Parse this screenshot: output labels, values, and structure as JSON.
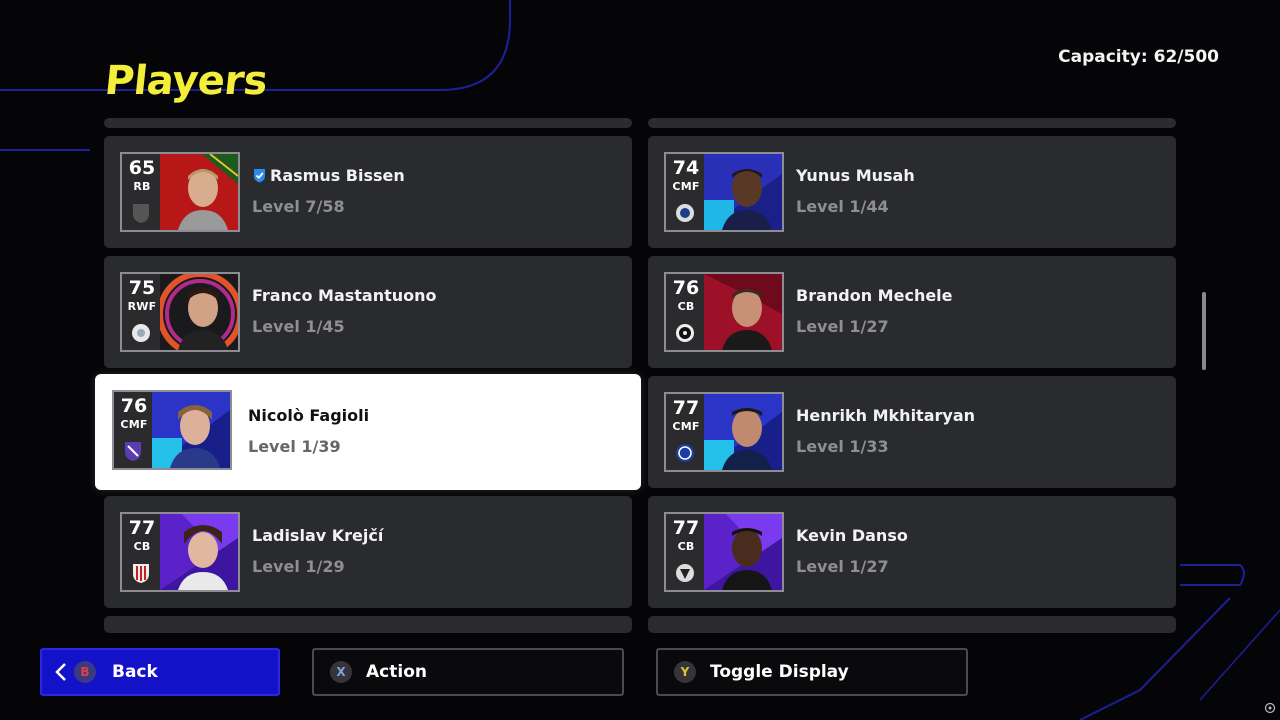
{
  "header": {
    "title": "Players",
    "capacity_label": "Capacity:",
    "capacity_value": "62/500"
  },
  "players": [
    {
      "name": "Rasmus Bissen",
      "level": "Level 7/58",
      "rating": "65",
      "position": "RB",
      "verified": true,
      "club_icon": "shield-crest-icon",
      "accent": "#c21d1d",
      "selected": false
    },
    {
      "name": "Yunus Musah",
      "level": "Level 1/44",
      "rating": "74",
      "position": "CMF",
      "verified": false,
      "club_icon": "club-crest-icon",
      "accent": "#2c38c8",
      "selected": false
    },
    {
      "name": "Franco Mastantuono",
      "level": "Level 1/45",
      "rating": "75",
      "position": "RWF",
      "verified": false,
      "club_icon": "club-crest-icon",
      "accent": "#d34a1f",
      "selected": false
    },
    {
      "name": "Brandon Mechele",
      "level": "Level 1/27",
      "rating": "76",
      "position": "CB",
      "verified": false,
      "club_icon": "club-crest-icon",
      "accent": "#a3122c",
      "selected": false
    },
    {
      "name": "Nicolò Fagioli",
      "level": "Level 1/39",
      "rating": "76",
      "position": "CMF",
      "verified": false,
      "club_icon": "club-crest-icon",
      "accent": "#2a3bd0",
      "selected": true
    },
    {
      "name": "Henrikh Mkhitaryan",
      "level": "Level 1/33",
      "rating": "77",
      "position": "CMF",
      "verified": false,
      "club_icon": "club-crest-icon",
      "accent": "#2a3bd0",
      "selected": false
    },
    {
      "name": "Ladislav Krejčí",
      "level": "Level 1/29",
      "rating": "77",
      "position": "CB",
      "verified": false,
      "club_icon": "club-crest-icon",
      "accent": "#6a2be0",
      "selected": false
    },
    {
      "name": "Kevin Danso",
      "level": "Level 1/27",
      "rating": "77",
      "position": "CB",
      "verified": false,
      "club_icon": "club-crest-icon",
      "accent": "#6a2be0",
      "selected": false
    }
  ],
  "footer": {
    "back": {
      "button": "B",
      "label": "Back"
    },
    "action": {
      "button": "X",
      "label": "Action"
    },
    "toggle": {
      "button": "Y",
      "label": "Toggle Display"
    }
  }
}
